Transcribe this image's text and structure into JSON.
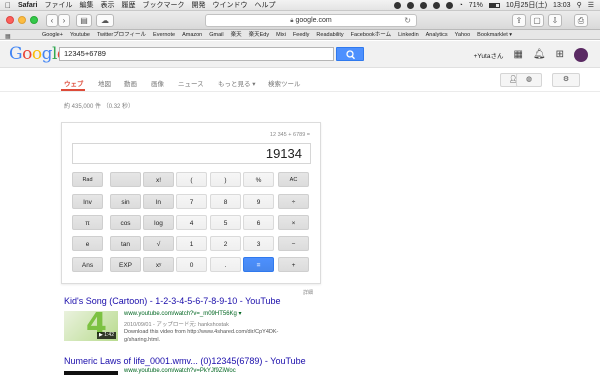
{
  "menubar": {
    "app": "Safari",
    "items": [
      "ファイル",
      "編集",
      "表示",
      "履歴",
      "ブックマーク",
      "開発",
      "ウインドウ",
      "ヘルプ"
    ],
    "battery": "71%",
    "date": "10月25日(土)",
    "time": "13:03"
  },
  "browser": {
    "url": "google.com",
    "bookmarks": [
      "Google+",
      "Youtube",
      "Twitterプロフィール",
      "Evernote",
      "Amazon",
      "Gmail",
      "楽天",
      "楽天Edy",
      "Mixi",
      "Feedly",
      "Readability",
      "Facebookホーム",
      "Linkedin",
      "Analytics",
      "Yahoo",
      "Bookmarklet ▾"
    ]
  },
  "google": {
    "logo": "Google",
    "query": "12345+6789",
    "user": "+Yutaさん",
    "tabs": [
      "ウェブ",
      "地図",
      "動画",
      "画像",
      "ニュース",
      "もっと見る ▾",
      "検索ツール"
    ],
    "stats": "約 435,000 件 （0.32 秒）"
  },
  "calculator": {
    "expression": "12 345 + 6789 =",
    "result": "19134",
    "keys": [
      [
        "Rad",
        "",
        "x!",
        "(",
        ")",
        "%",
        "AC"
      ],
      [
        "Inv",
        "sin",
        "ln",
        "7",
        "8",
        "9",
        "÷"
      ],
      [
        "π",
        "cos",
        "log",
        "4",
        "5",
        "6",
        "×"
      ],
      [
        "e",
        "tan",
        "√",
        "1",
        "2",
        "3",
        "−"
      ],
      [
        "Ans",
        "EXP",
        "xʸ",
        "0",
        ".",
        "=",
        "+"
      ]
    ],
    "detail_link": "詳細"
  },
  "results": [
    {
      "title": "Kid's Song (Cartoon) - 1-2-3-4-5-6-7-8-9-10 - YouTube",
      "url": "www.youtube.com/watch?v=_m09HT56Kg ▾",
      "meta": "2010/09/01 - アップロード元: hankshostak",
      "snippet": "Download this video from http://www.4shared.com/dir/CpY4DK-g/sharing.html.",
      "duration": "▶ 1:42",
      "thumb_glyph": "4"
    },
    {
      "title": "Numeric Laws of life_0001.wmv... (0)12345(6789) - YouTube",
      "url": "www.youtube.com/watch?v=PkYJf9ZiWoc"
    }
  ]
}
